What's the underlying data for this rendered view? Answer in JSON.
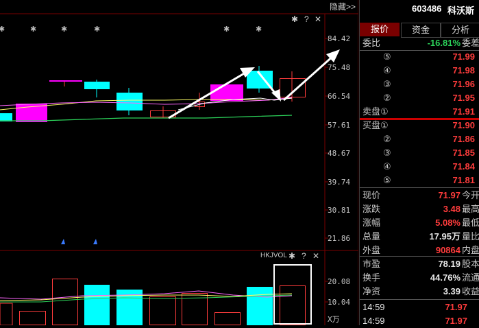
{
  "header": {
    "hide_label": "隐藏>>",
    "stock_code": "603486",
    "stock_name": "科沃斯"
  },
  "price_axis": [
    "84.42",
    "75.48",
    "66.54",
    "57.61",
    "48.67",
    "39.74",
    "30.81",
    "21.86"
  ],
  "volume_panel": {
    "indicator": "HKJVOL",
    "axis": [
      "20.08",
      "10.04"
    ],
    "unit": "X万"
  },
  "icons": {
    "gear": "gear-icon",
    "help": "help-icon",
    "close": "close-icon"
  },
  "help_glyph": "?",
  "close_glyph": "✕",
  "gear_glyph": "✱",
  "tabs": [
    "报价",
    "资金",
    "分析"
  ],
  "weibi": {
    "label": "委比",
    "value": "-16.81%",
    "extra": "委差"
  },
  "sell": {
    "label": "卖盘",
    "levels": [
      {
        "num": "⑤",
        "price": "71.99"
      },
      {
        "num": "④",
        "price": "71.98"
      },
      {
        "num": "③",
        "price": "71.96"
      },
      {
        "num": "②",
        "price": "71.95"
      },
      {
        "num": "①",
        "price": "71.91"
      }
    ]
  },
  "buy": {
    "label": "买盘",
    "levels": [
      {
        "num": "①",
        "price": "71.90"
      },
      {
        "num": "②",
        "price": "71.86"
      },
      {
        "num": "③",
        "price": "71.85"
      },
      {
        "num": "④",
        "price": "71.84"
      },
      {
        "num": "⑤",
        "price": "71.81"
      }
    ]
  },
  "stats": [
    {
      "label": "现价",
      "value": "71.97",
      "extra": "今开",
      "color": "red"
    },
    {
      "label": "涨跌",
      "value": "3.48",
      "extra": "最高",
      "color": "red"
    },
    {
      "label": "涨幅",
      "value": "5.08%",
      "extra": "最低",
      "color": "red"
    },
    {
      "label": "总量",
      "value": "17.95万",
      "extra": "量比",
      "color": "white"
    },
    {
      "label": "外盘",
      "value": "90864",
      "extra": "内盘",
      "color": "red"
    }
  ],
  "stats2": [
    {
      "label": "市盈",
      "value": "78.19",
      "extra": "股本",
      "color": "white"
    },
    {
      "label": "换手",
      "value": "44.76%",
      "extra": "流通",
      "color": "white"
    },
    {
      "label": "净资",
      "value": "3.39",
      "extra": "收益",
      "color": "white"
    }
  ],
  "ticks": [
    {
      "time": "14:59",
      "price": "71.97"
    },
    {
      "time": "14:59",
      "price": "71.97"
    }
  ],
  "colors": {
    "up": "#ff3c3c",
    "down": "#00e0ff",
    "magenta": "#ff00ff",
    "green": "#2cd35a",
    "yellow": "#ffff00"
  }
}
